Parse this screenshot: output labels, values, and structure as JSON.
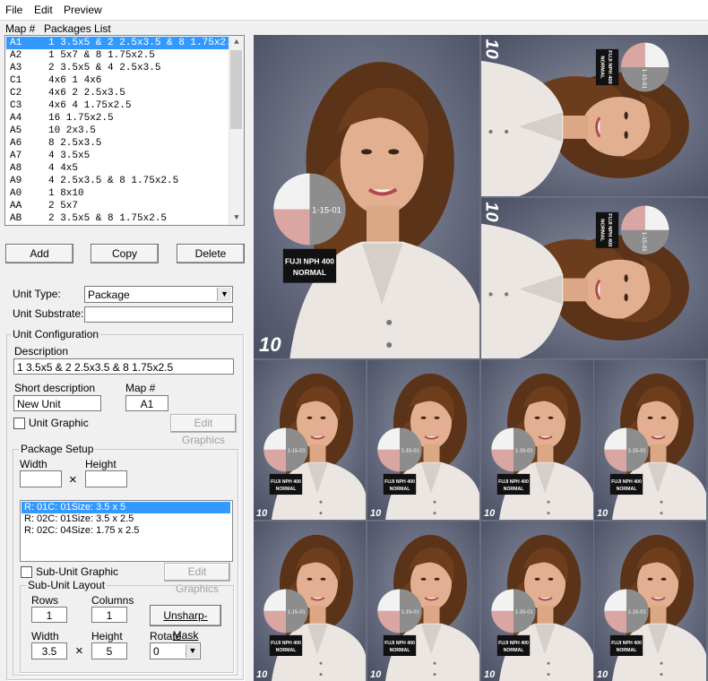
{
  "menu": [
    "File",
    "Edit",
    "Preview"
  ],
  "list_headers": {
    "map": "Map #",
    "packages": "Packages List"
  },
  "packages": [
    {
      "code": "A1",
      "desc": "1 3.5x5 & 2 2.5x3.5 & 8 1.75x2.5",
      "selected": true
    },
    {
      "code": "A2",
      "desc": "1 5x7 & 8 1.75x2.5"
    },
    {
      "code": "A3",
      "desc": "2 3.5x5 & 4 2.5x3.5"
    },
    {
      "code": "C1",
      "desc": "4x6 1 4x6"
    },
    {
      "code": "C2",
      "desc": "4x6 2 2.5x3.5"
    },
    {
      "code": "C3",
      "desc": "4x6 4 1.75x2.5"
    },
    {
      "code": "A4",
      "desc": "16 1.75x2.5"
    },
    {
      "code": "A5",
      "desc": "10 2x3.5"
    },
    {
      "code": "A6",
      "desc": "8 2.5x3.5"
    },
    {
      "code": "A7",
      "desc": "4 3.5x5"
    },
    {
      "code": "A8",
      "desc": "4 4x5"
    },
    {
      "code": "A9",
      "desc": "4 2.5x3.5 & 8 1.75x2.5"
    },
    {
      "code": "A0",
      "desc": "1 8x10"
    },
    {
      "code": "AA",
      "desc": "2 5x7"
    },
    {
      "code": "AB",
      "desc": "2 3.5x5 & 8 1.75x2.5"
    }
  ],
  "buttons": {
    "add": "Add",
    "copy": "Copy",
    "delete": "Delete",
    "edit_graphics": "Edit Graphics",
    "sub_edit_graphics": "Edit Graphics",
    "unsharp": "Unsharp-Mask"
  },
  "unit": {
    "type_label": "Unit Type:",
    "type_value": "Package",
    "substrate_label": "Unit Substrate:",
    "substrate_value": "",
    "config_legend": "Unit Configuration",
    "description_label": "Description",
    "description_value": "1 3.5x5 & 2 2.5x3.5 & 8 1.75x2.5",
    "short_label": "Short description",
    "short_value": "New Unit",
    "map_label": "Map #",
    "map_value": "A1",
    "graphic_label": "Unit Graphic"
  },
  "package_setup": {
    "legend": "Package Setup",
    "width_label": "Width",
    "height_label": "Height",
    "width_value": "",
    "height_value": "",
    "times": "×",
    "items": [
      {
        "text": "R: 01C: 01Size: 3.5 x 5",
        "selected": true
      },
      {
        "text": "R: 02C: 01Size: 3.5 x 2.5"
      },
      {
        "text": "R: 02C: 04Size: 1.75 x 2.5"
      }
    ],
    "sub_graphic_label": "Sub-Unit Graphic"
  },
  "sub_layout": {
    "legend": "Sub-Unit Layout",
    "rows_label": "Rows",
    "rows_value": "1",
    "cols_label": "Columns",
    "cols_value": "1",
    "width_label": "Width",
    "width_value": "3.5",
    "height_label": "Height",
    "height_value": "5",
    "rotate_label": "Rotate",
    "rotate_value": "0",
    "times": "×"
  },
  "photo": {
    "card_date": "1-15-01",
    "film_line1": "FUJI NPH 400",
    "film_line2": "NORMAL",
    "corner": "10"
  },
  "colors": {
    "selection": "#3399ff",
    "backdrop": "#6a6f80"
  }
}
